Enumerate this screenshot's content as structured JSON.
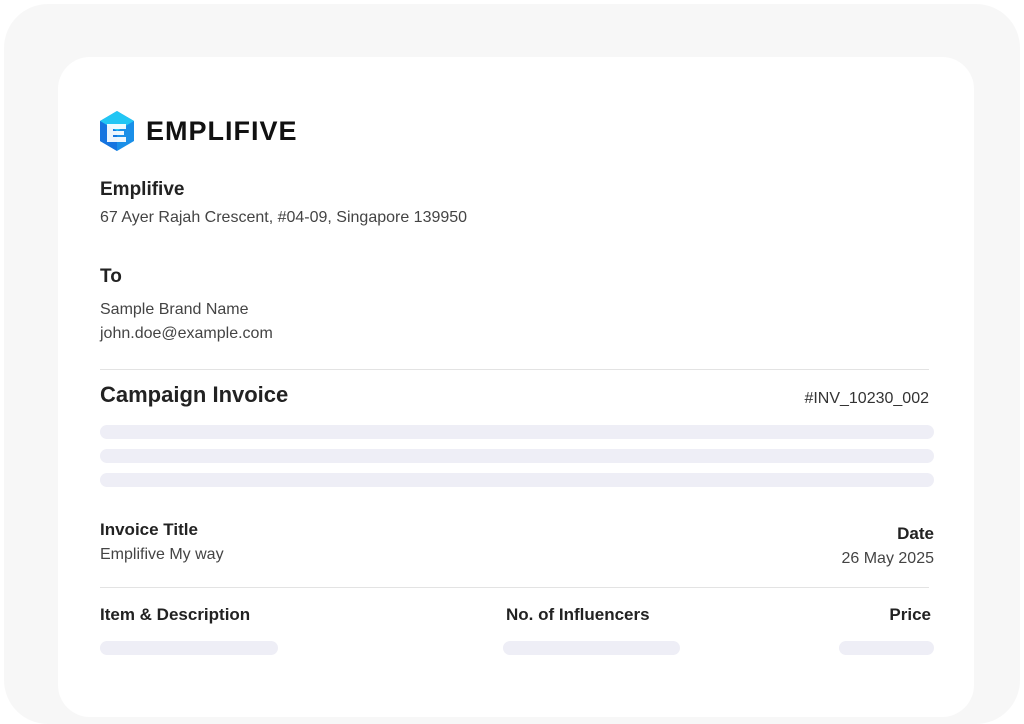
{
  "brand": {
    "logo_text": "EMPLIFIVE",
    "logo_icon": "emplifive-hex-logo-icon",
    "accent_colors": [
      "#1ec0f2",
      "#1a8fe8",
      "#1560d8"
    ]
  },
  "sender": {
    "name": "Emplifive",
    "address": "67 Ayer Rajah Crescent, #04-09, Singapore 139950"
  },
  "recipient": {
    "label": "To",
    "name": "Sample Brand Name",
    "email": "john.doe@example.com"
  },
  "invoice": {
    "heading": "Campaign Invoice",
    "number": "#INV_10230_002",
    "title_label": "Invoice Title",
    "title_value": "Emplifive My way",
    "date_label": "Date",
    "date_value": "26 May 2025"
  },
  "table": {
    "columns": [
      "Item & Description",
      "No. of Influencers",
      "Price"
    ]
  },
  "colors": {
    "placeholder": "#eeeef6",
    "divider": "#e3e3e3",
    "background_frame": "#f7f7f7"
  }
}
